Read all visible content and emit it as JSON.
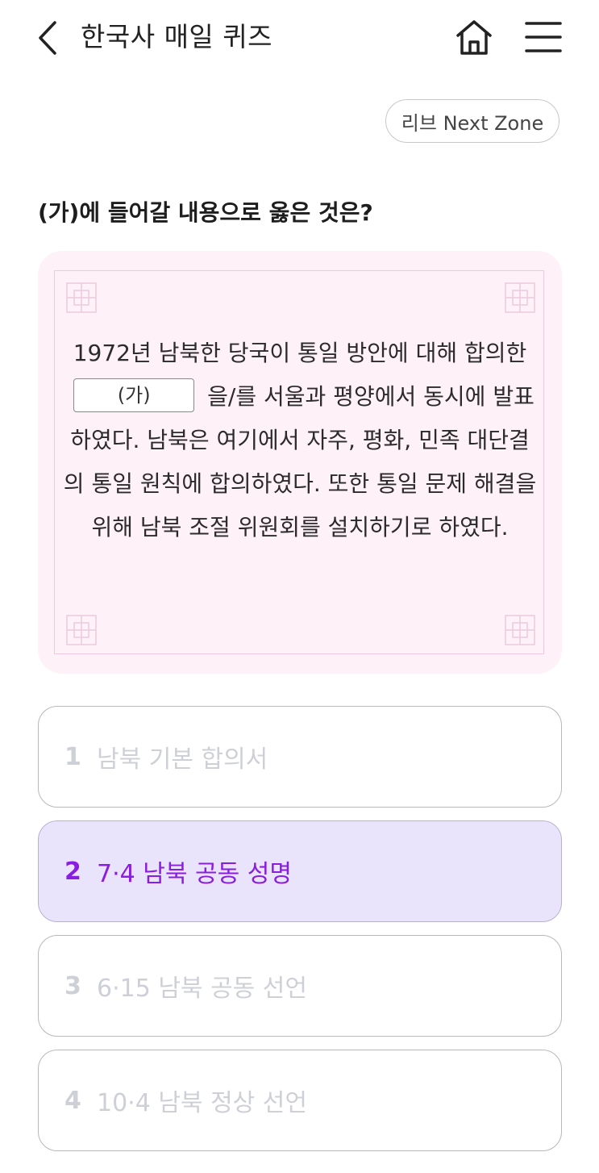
{
  "header": {
    "title": "한국사 매일 퀴즈",
    "back_icon": "chevron-left-icon",
    "home_icon": "home-icon",
    "menu_icon": "hamburger-menu-icon"
  },
  "next_zone_label": "리브 Next Zone",
  "question": "(가)에 들어갈 내용으로 옳은 것은?",
  "passage": {
    "before_blank": "1972년 남북한 당국이 통일 방안에 대해 합의한",
    "blank_label": "(가)",
    "after_blank": "을/를 서울과 평양에서 동시에 발표하였다. 남북은 여기에서 자주, 평화, 민족 대단결의 통일 원칙에 합의하였다. 또한 통일 문제 해결을 위해 남북 조절 위원회를 설치하기로 하였다.",
    "background_color": "#fff1f8"
  },
  "options": [
    {
      "number": "1",
      "text": "남북 기본 합의서",
      "selected": false
    },
    {
      "number": "2",
      "text": "7·4 남북 공동 성명",
      "selected": true
    },
    {
      "number": "3",
      "text": "6·15 남북 공동 선언",
      "selected": false
    },
    {
      "number": "4",
      "text": "10·4 남북 정상 선언",
      "selected": false
    }
  ],
  "colors": {
    "selected_text": "#8a1de0",
    "selected_bg": "#e9e4fc",
    "unselected_text": "#cdd0d6"
  }
}
